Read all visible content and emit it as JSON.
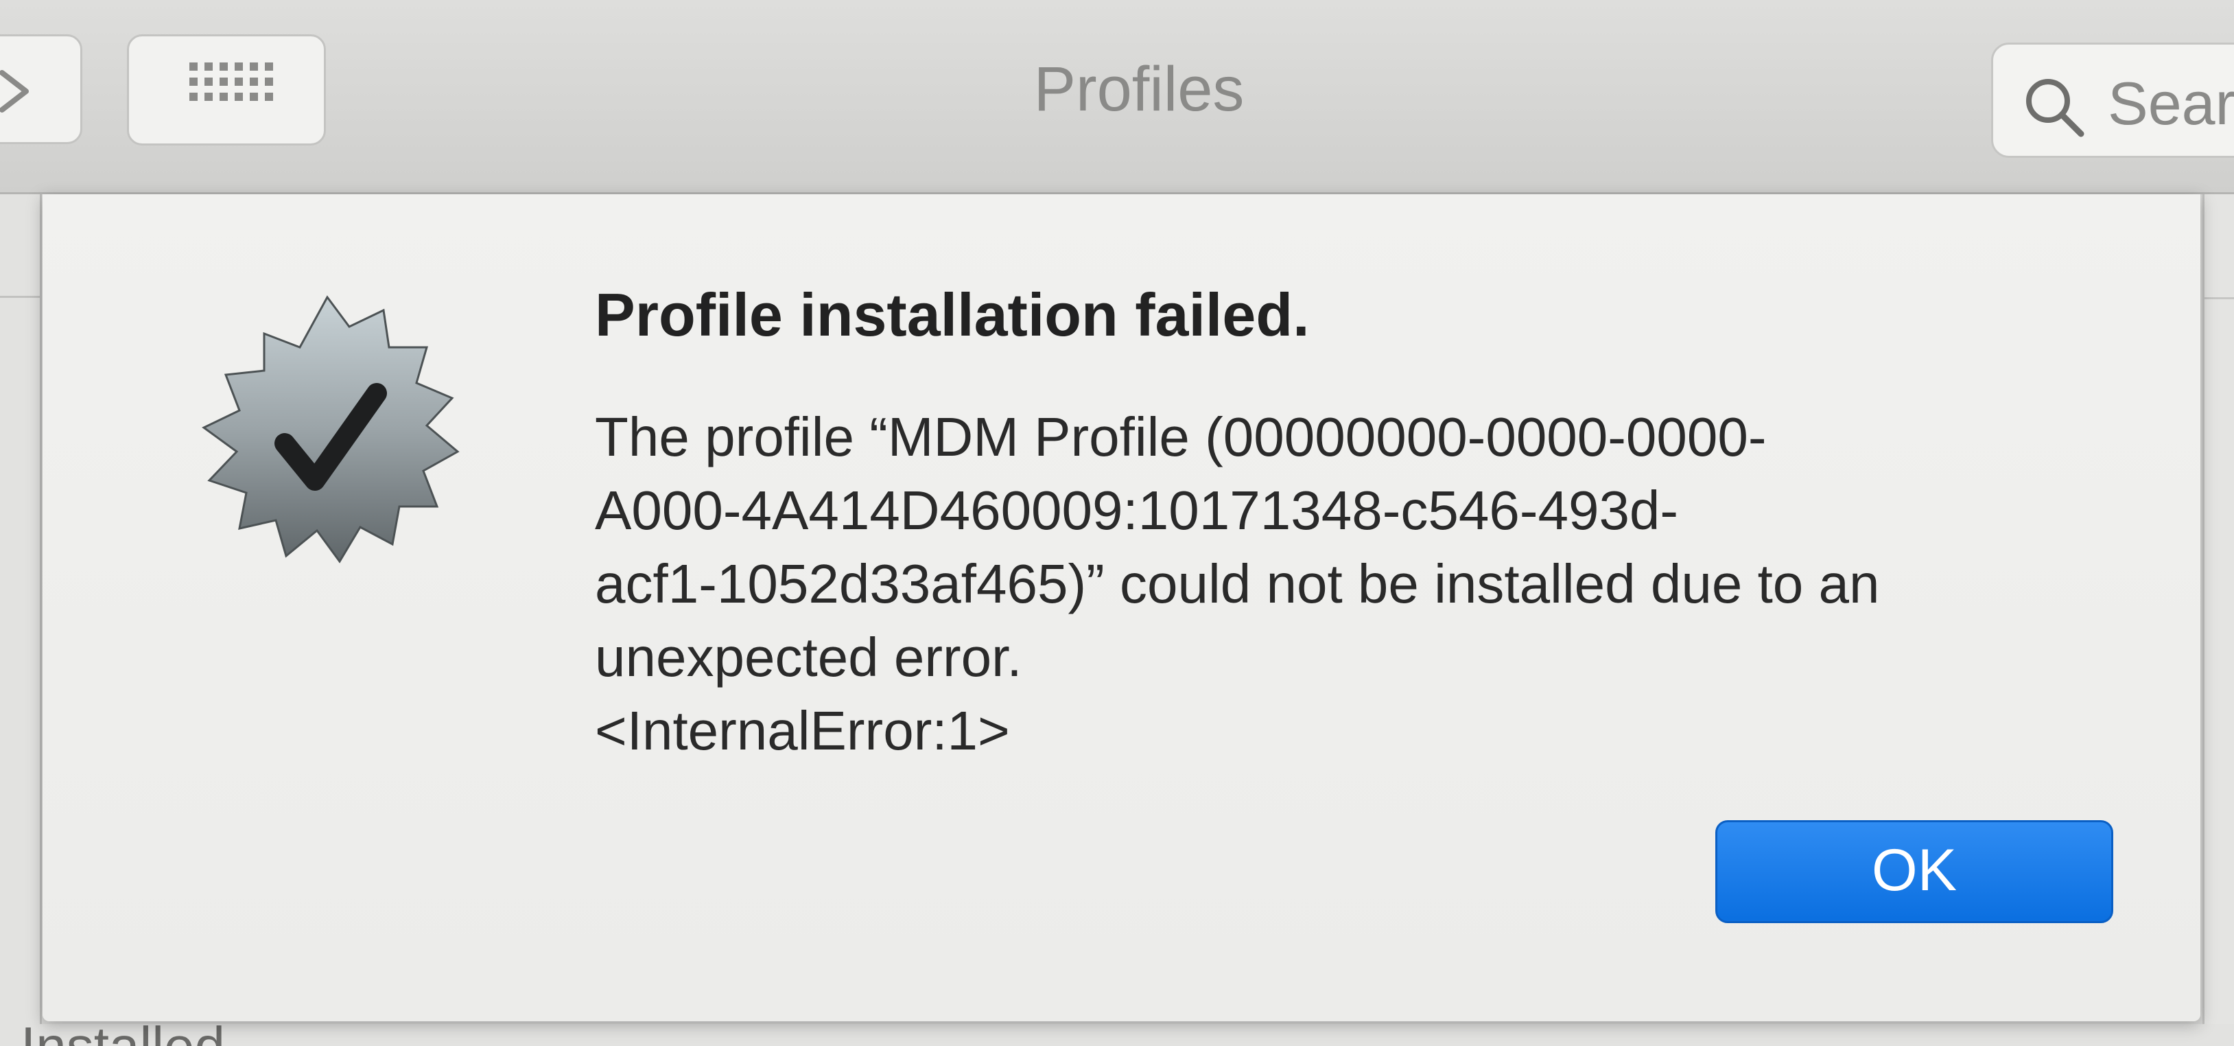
{
  "toolbar": {
    "title": "Profiles",
    "search_placeholder": "Sear",
    "back_icon": "chevron-right-icon",
    "grid_icon": "grid-icon",
    "search_icon": "search-icon"
  },
  "background": {
    "installed_text": "Installed"
  },
  "dialog": {
    "icon": "verified-badge-icon",
    "heading": "Profile installation failed.",
    "message_lines": [
      "The profile “MDM Profile (00000000-0000-0000-",
      "A000-4A414D460009:10171348-c546-493d-",
      "acf1-1052d33af465)” could not be installed due to an",
      "unexpected error.",
      "<InternalError:1>"
    ],
    "ok_label": "OK"
  },
  "colors": {
    "accent": "#0b6fe0",
    "sheet_bg": "#eeeeec",
    "toolbar_bg": "#d8d8d6"
  }
}
